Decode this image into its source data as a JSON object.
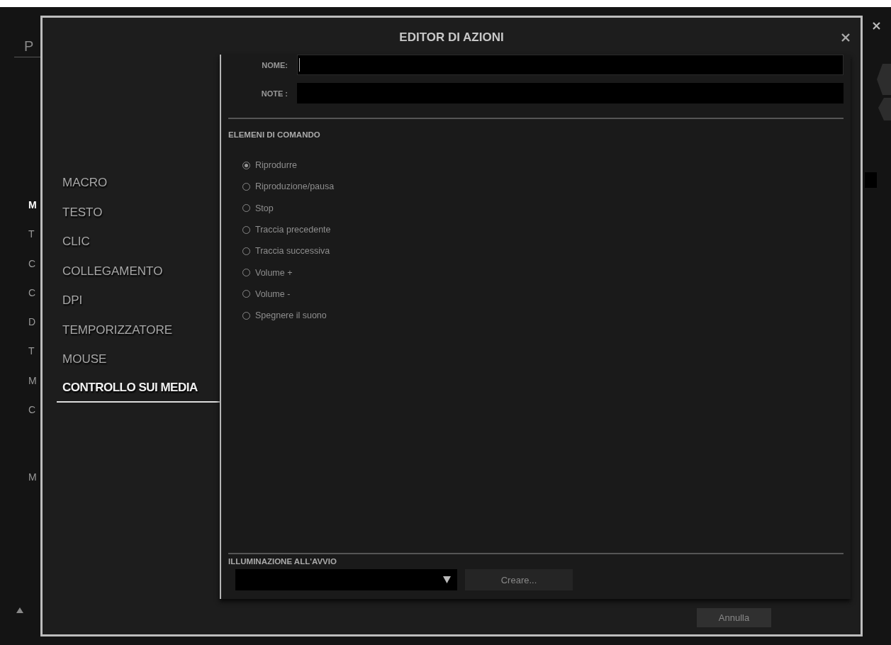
{
  "background_app": {
    "tab": "P",
    "menu_items": [
      {
        "label": "M",
        "selected": true
      },
      {
        "label": "T",
        "selected": false
      },
      {
        "label": "C",
        "selected": false
      },
      {
        "label": "C",
        "selected": false
      },
      {
        "label": "D",
        "selected": false
      },
      {
        "label": "T",
        "selected": false
      },
      {
        "label": "M",
        "selected": false
      },
      {
        "label": "C",
        "selected": false
      },
      {
        "label": "M",
        "selected": false
      }
    ]
  },
  "dialog": {
    "title": "EDITOR DI AZIONI",
    "nav_items": [
      {
        "label": "MACRO",
        "selected": false
      },
      {
        "label": "TESTO",
        "selected": false
      },
      {
        "label": "CLIC",
        "selected": false
      },
      {
        "label": "COLLEGAMENTO",
        "selected": false
      },
      {
        "label": "DPI",
        "selected": false
      },
      {
        "label": "TEMPORIZZATORE",
        "selected": false
      },
      {
        "label": "MOUSE",
        "selected": false
      },
      {
        "label": "CONTROLLO SUI MEDIA",
        "selected": true
      }
    ],
    "fields": [
      {
        "label": "NOME:",
        "focused": true
      },
      {
        "label": "NOTE :",
        "focused": false
      }
    ],
    "commands": {
      "heading": "ELEMENI DI COMANDO",
      "options": [
        {
          "label": "Riprodurre",
          "selected": true
        },
        {
          "label": "Riproduzione/pausa",
          "selected": false
        },
        {
          "label": "Stop",
          "selected": false
        },
        {
          "label": "Traccia precedente",
          "selected": false
        },
        {
          "label": "Traccia successiva",
          "selected": false
        },
        {
          "label": "Volume +",
          "selected": false
        },
        {
          "label": "Volume -",
          "selected": false
        },
        {
          "label": "Spegnere il suono",
          "selected": false
        }
      ]
    },
    "lighting": {
      "heading": "ILLUMINAZIONE ALL'AVVIO",
      "button": "Creare..."
    },
    "footer_buttons": [
      "Annulla"
    ]
  }
}
